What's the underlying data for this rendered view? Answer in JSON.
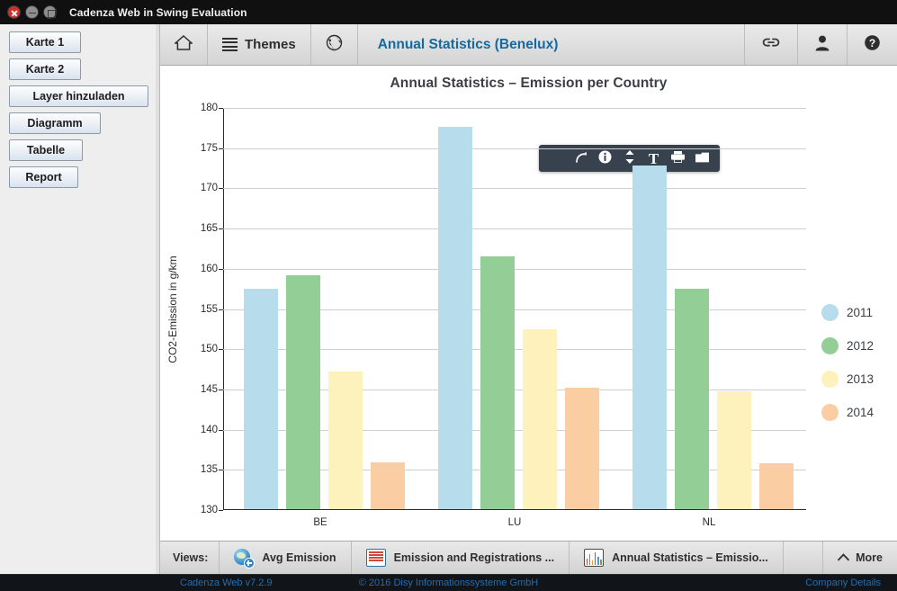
{
  "window": {
    "title": "Cadenza Web in Swing Evaluation",
    "controls": {
      "close": "close-window",
      "minimize": "minimize-window",
      "maximize": "maximize-window"
    }
  },
  "sidebar": {
    "buttons": [
      {
        "label": "Karte 1"
      },
      {
        "label": "Karte 2"
      },
      {
        "label": "Layer hinzuladen"
      },
      {
        "label": "Diagramm"
      },
      {
        "label": "Tabelle"
      },
      {
        "label": "Report"
      }
    ]
  },
  "toolbar": {
    "home_icon": "home-icon",
    "themes_label": "Themes",
    "themes_icon": "hamburger-icon",
    "globe_icon": "globe-icon",
    "title": "Annual Statistics (Benelux)",
    "title_color": "#17699e",
    "link_icon": "link-icon",
    "user_icon": "user-icon",
    "help_icon": "help-icon"
  },
  "float_toolbar": {
    "background": "#38414e",
    "items": [
      {
        "icon": "drag-handle-icon",
        "glyph": ""
      },
      {
        "icon": "redo-icon",
        "glyph": "↷"
      },
      {
        "icon": "info-icon",
        "glyph": "i"
      },
      {
        "icon": "sort-vertical-icon",
        "glyph": "⌃⌄"
      },
      {
        "icon": "text-tool-icon",
        "glyph": "T"
      },
      {
        "icon": "print-icon",
        "glyph": "print"
      },
      {
        "icon": "folder-icon",
        "glyph": "folder"
      }
    ]
  },
  "chart_data": {
    "type": "bar",
    "title": "Annual Statistics – Emission per Country",
    "xlabel": "",
    "ylabel": "CO2-Emission in g/km",
    "categories": [
      "BE",
      "LU",
      "NL"
    ],
    "ylim": [
      130,
      180
    ],
    "yticks": [
      130,
      135,
      140,
      145,
      150,
      155,
      160,
      165,
      170,
      175,
      180
    ],
    "grid": true,
    "legend_position": "right",
    "series": [
      {
        "name": "2011",
        "color": "#b7dcec",
        "values": [
          157.5,
          177.7,
          172.8
        ]
      },
      {
        "name": "2012",
        "color": "#94ce97",
        "values": [
          159.2,
          161.5,
          157.5
        ]
      },
      {
        "name": "2013",
        "color": "#fdf2bb",
        "values": [
          147.2,
          152.5,
          144.8
        ]
      },
      {
        "name": "2014",
        "color": "#fbcda3",
        "values": [
          135.9,
          145.2,
          135.8
        ]
      }
    ]
  },
  "views_bar": {
    "label": "Views:",
    "items": [
      {
        "label": "Avg Emission",
        "icon": "globe-plus-icon"
      },
      {
        "label": "Emission and Registrations ...",
        "icon": "table-icon"
      },
      {
        "label": "Annual Statistics – Emissio...",
        "icon": "bar-chart-icon"
      }
    ],
    "more_label": "More",
    "more_icon": "chevron-up-icon"
  },
  "footer": {
    "version": "Cadenza Web v7.2.9",
    "copyright": "© 2016 Disy Informationssysteme GmbH",
    "company_link": "Company Details",
    "link_color": "#1f6fb2"
  }
}
